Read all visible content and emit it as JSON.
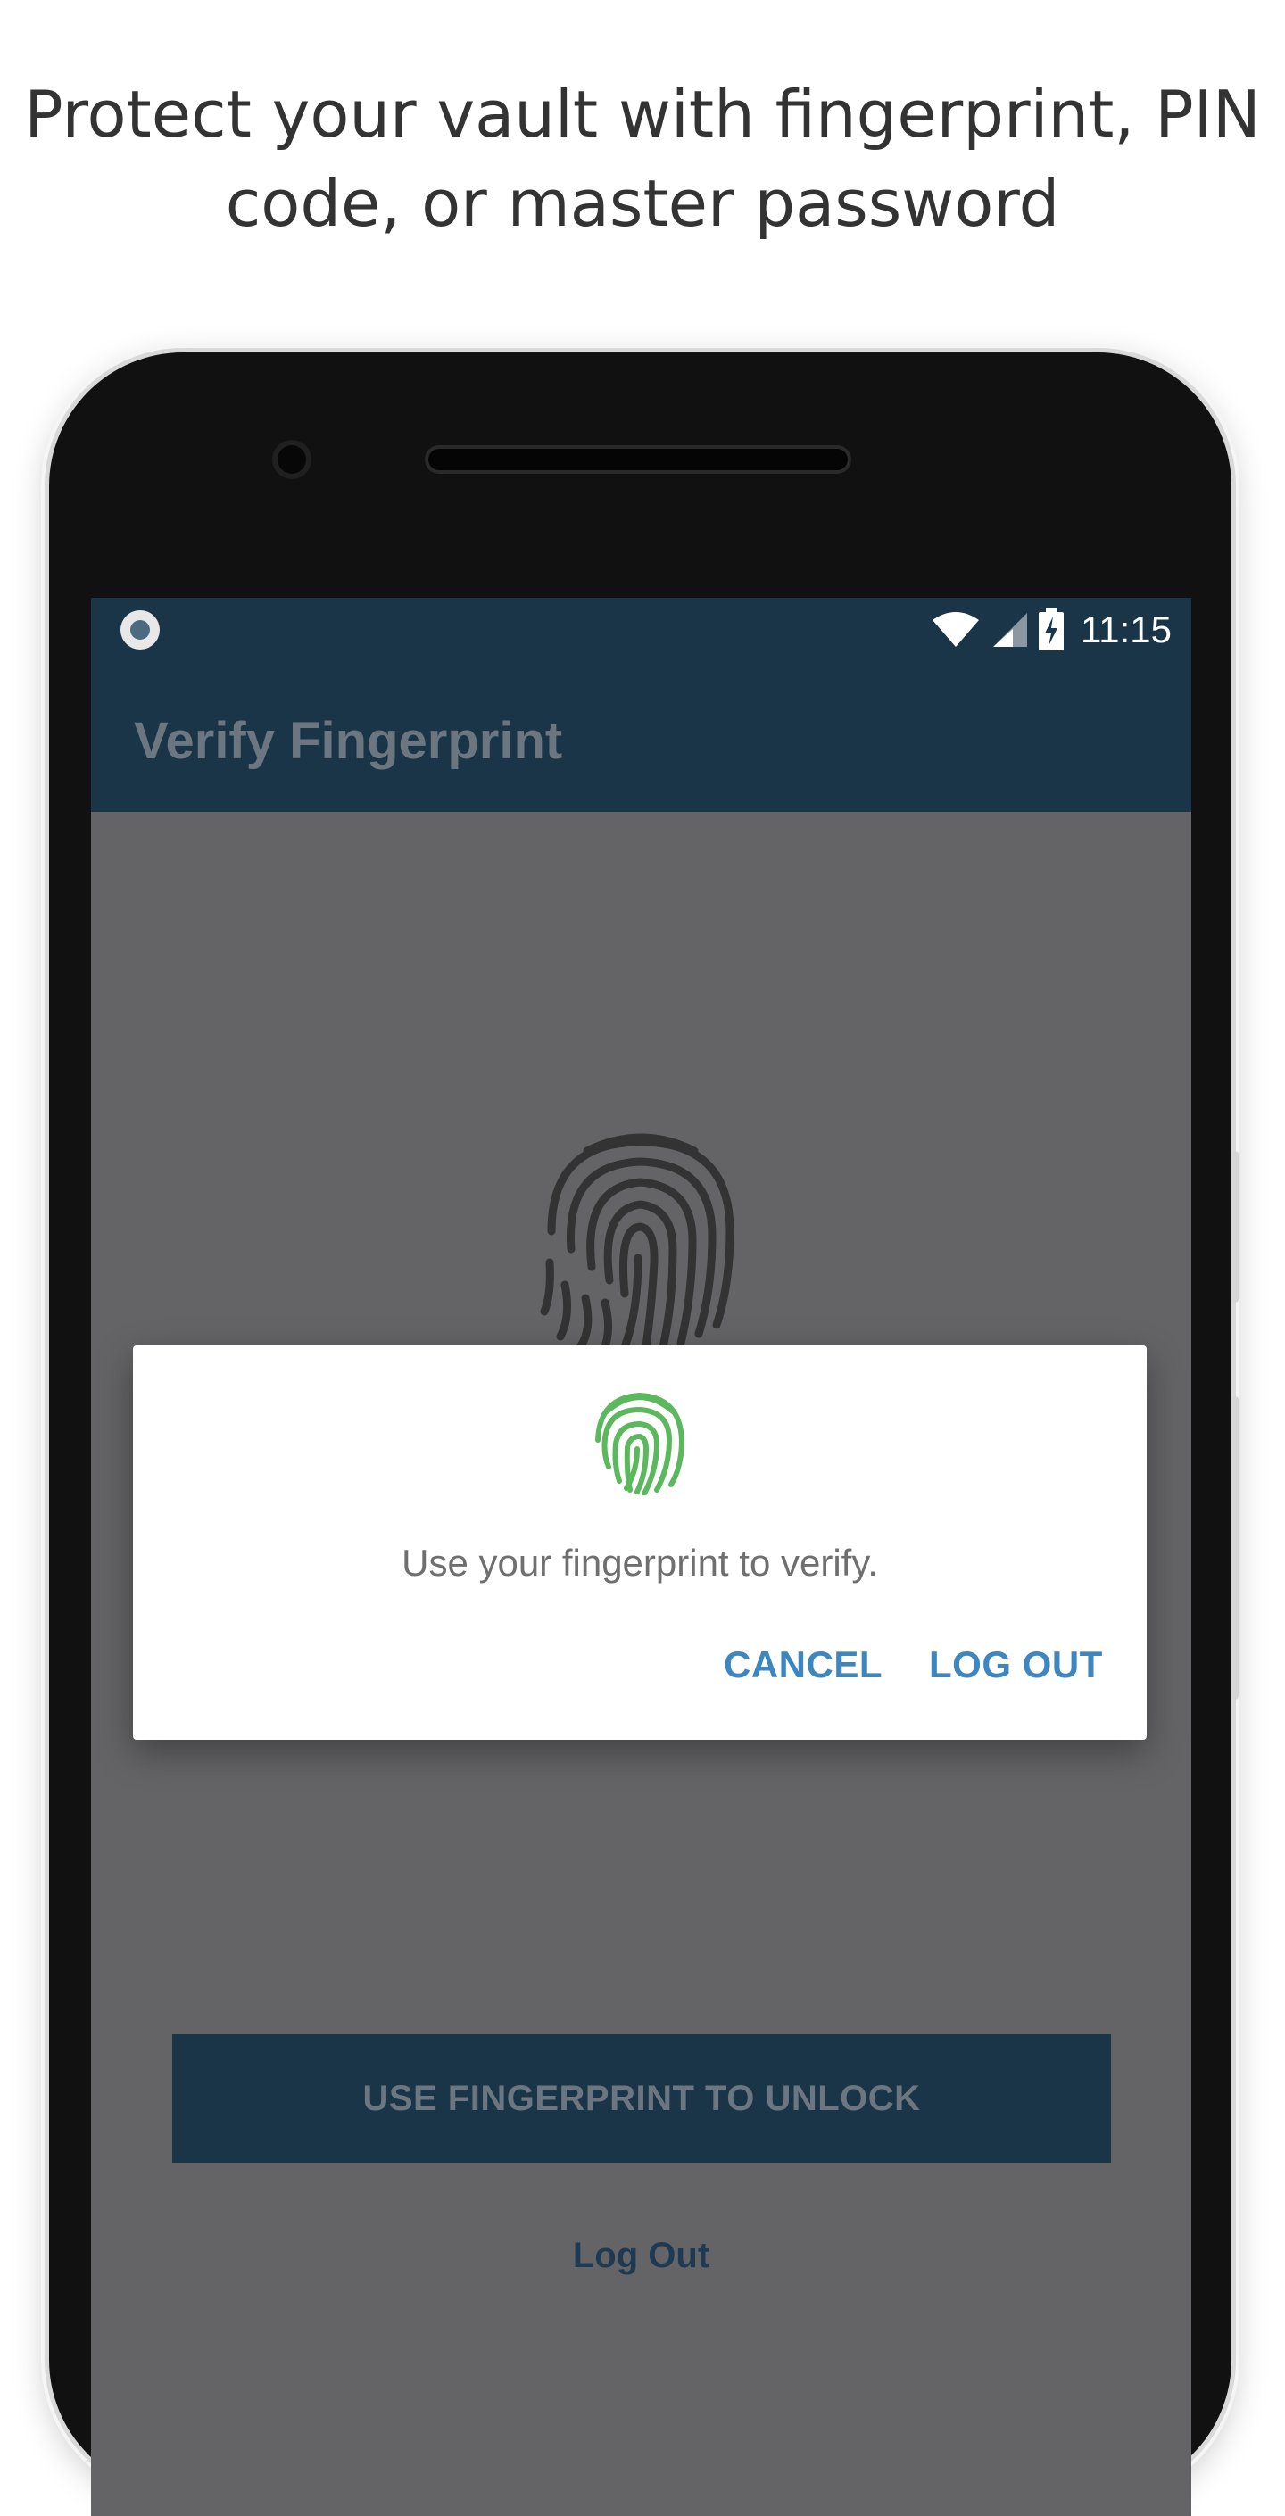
{
  "headline": {
    "line1": "Protect your vault with fingerprint, PIN",
    "line2": "code, or master password"
  },
  "status_bar": {
    "time": "11:15",
    "icons": [
      "record-icon",
      "wifi-icon",
      "cell-signal-icon",
      "battery-charging-icon"
    ]
  },
  "app_bar": {
    "title": "Verify Fingerprint"
  },
  "screen": {
    "unlock_button": "USE FINGERPRINT TO UNLOCK",
    "logout_link": "Log Out",
    "background_icon": "fingerprint-icon"
  },
  "dialog": {
    "icon": "fingerprint-icon",
    "icon_color": "#5cb85c",
    "message": "Use your fingerprint to verify.",
    "cancel_label": "CANCEL",
    "logout_label": "LOG OUT",
    "button_color": "#3e86c1"
  },
  "colors": {
    "primary_dark": "#1a3548",
    "overlay_gray": "#646466"
  }
}
